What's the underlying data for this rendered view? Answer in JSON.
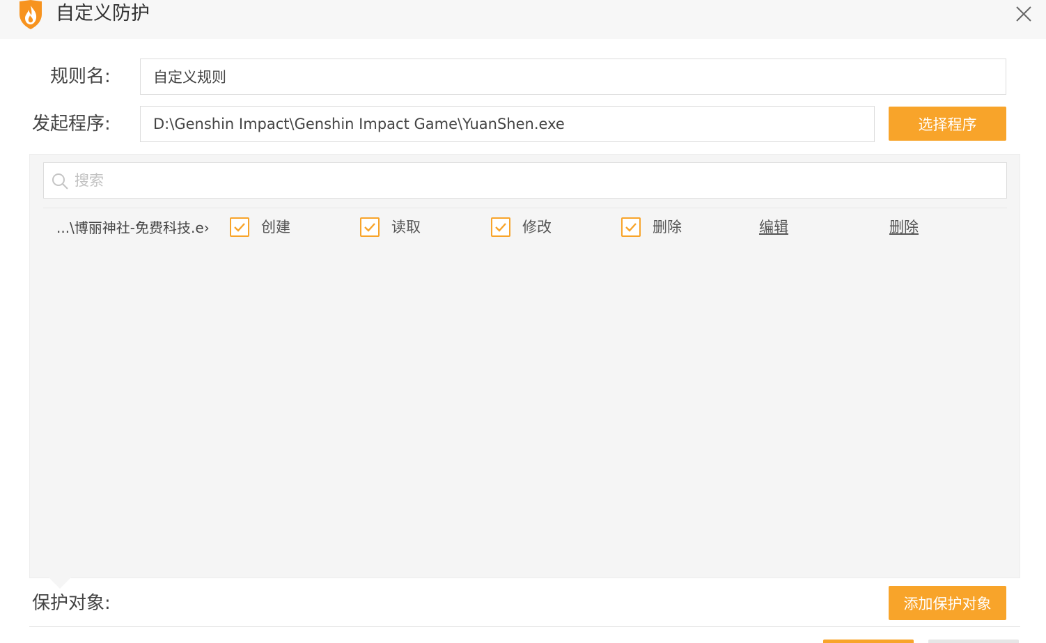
{
  "window": {
    "title": "自定义防护",
    "logo_icon": "flame-shield-icon",
    "close_icon": "close-icon"
  },
  "form": {
    "rule_name_label": "规则名:",
    "rule_name_value": "自定义规则",
    "program_label": "发起程序:",
    "program_value": "D:\\Genshin Impact\\Genshin Impact Game\\YuanShen.exe",
    "choose_program_button": "选择程序"
  },
  "search": {
    "placeholder": "搜索",
    "icon": "search-icon"
  },
  "rules": [
    {
      "name": "...\\博丽神社-免费科技.e›",
      "permissions": [
        {
          "label": "创建",
          "checked": true
        },
        {
          "label": "读取",
          "checked": true
        },
        {
          "label": "修改",
          "checked": true
        },
        {
          "label": "删除",
          "checked": true
        }
      ],
      "edit_link": "编辑",
      "delete_link": "删除"
    }
  ],
  "protected_objects": {
    "label": "保护对象:",
    "add_button": "添加保护对象"
  },
  "colors": {
    "accent": "#f8a42a",
    "panel_bg": "#f5f5f5",
    "titlebar_bg": "#f7f7f7"
  }
}
